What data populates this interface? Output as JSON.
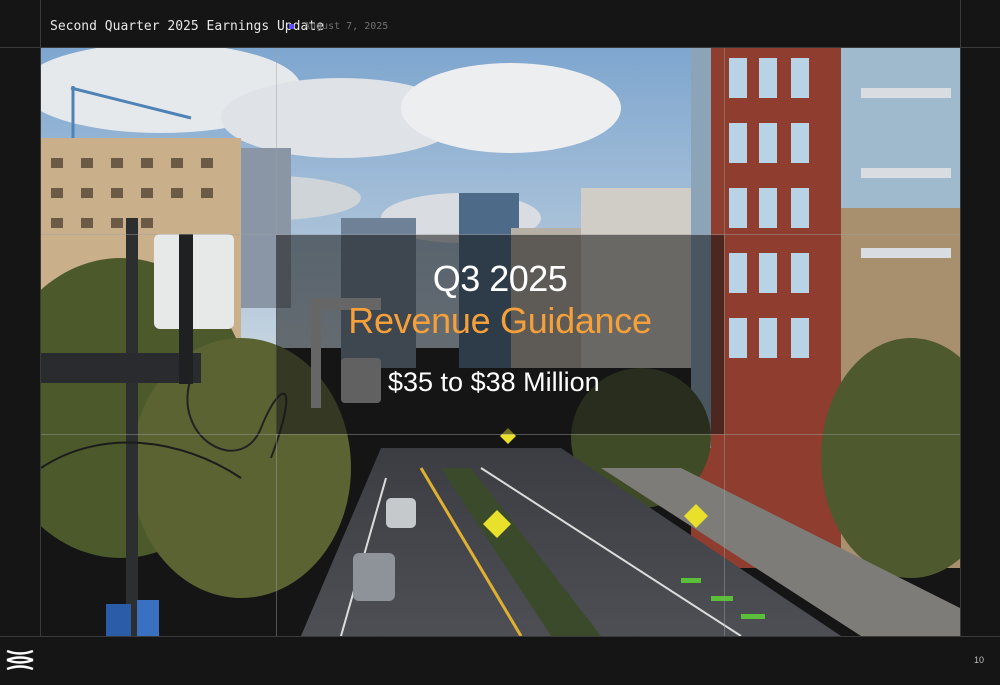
{
  "header": {
    "title": "Second Quarter 2025 Earnings Update",
    "date": "August 7, 2025",
    "accent_color": "#5a4cff"
  },
  "hero": {
    "title": "Q3 2025",
    "subtitle": "Revenue Guidance",
    "value": "$35 to $38 Million",
    "subtitle_color": "#f5a03a",
    "background_image": "city-street-photo"
  },
  "footer": {
    "logo_icon": "company-logo-icon",
    "page_number": "10"
  }
}
